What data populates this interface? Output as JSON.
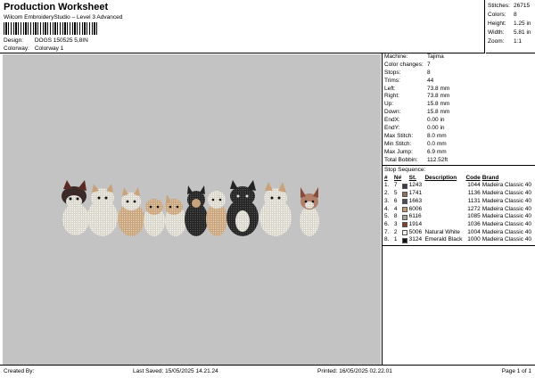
{
  "header": {
    "title": "Production Worksheet",
    "subtitle": "Wilcom EmbroideryStudio – Level 3 Advanced",
    "design_label": "Design:",
    "design_value": "DOGS 150525 5,8IN",
    "colorway_label": "Colorway:",
    "colorway_value": "Colorway 1"
  },
  "summary": {
    "stitches_label": "Stitches:",
    "stitches": "26715",
    "colors_label": "Colors:",
    "colors": "8",
    "height_label": "Height:",
    "height": "1.25 in",
    "width_label": "Width:",
    "width": "5.81 in",
    "zoom_label": "Zoom:",
    "zoom": "1:1"
  },
  "stats": [
    {
      "k": "Machine:",
      "v": "Tajima"
    },
    {
      "k": "Color changes:",
      "v": "7"
    },
    {
      "k": "Stops:",
      "v": "8"
    },
    {
      "k": "Trims:",
      "v": "44"
    },
    {
      "k": "Left:",
      "v": "73.8 mm"
    },
    {
      "k": "Right:",
      "v": "73.8 mm"
    },
    {
      "k": "Up:",
      "v": "15.8 mm"
    },
    {
      "k": "Down:",
      "v": "15.8 mm"
    },
    {
      "k": "EndX:",
      "v": "0.00 in"
    },
    {
      "k": "EndY:",
      "v": "0.00 in"
    },
    {
      "k": "Max Stitch:",
      "v": "8.0 mm"
    },
    {
      "k": "Min Stitch:",
      "v": "0.0 mm"
    },
    {
      "k": "Max Jump:",
      "v": "6.9 mm"
    },
    {
      "k": "Total Bobbin:",
      "v": "112.52ft"
    }
  ],
  "stop_sequence": {
    "title": "Stop Sequence:",
    "headers": {
      "num": "#",
      "n": "N#",
      "st": "St.",
      "desc": "Description",
      "code": "Code",
      "brand": "Brand"
    },
    "rows": [
      {
        "num": "1.",
        "n": "7",
        "color": "#3b3a4a",
        "st": "1243",
        "desc": "",
        "code": "1044",
        "brand": "Madeira Classic 40"
      },
      {
        "num": "2.",
        "n": "5",
        "color": "#8a7060",
        "st": "1741",
        "desc": "",
        "code": "1136",
        "brand": "Madeira Classic 40"
      },
      {
        "num": "3.",
        "n": "6",
        "color": "#4a4e58",
        "st": "1663",
        "desc": "",
        "code": "1131",
        "brand": "Madeira Classic 40"
      },
      {
        "num": "4.",
        "n": "4",
        "color": "#c89a72",
        "st": "6006",
        "desc": "",
        "code": "1272",
        "brand": "Madeira Classic 40"
      },
      {
        "num": "5.",
        "n": "8",
        "color": "#a8a49a",
        "st": "6116",
        "desc": "",
        "code": "1085",
        "brand": "Madeira Classic 40"
      },
      {
        "num": "6.",
        "n": "3",
        "color": "#7a4030",
        "st": "1914",
        "desc": "",
        "code": "1036",
        "brand": "Madeira Classic 40"
      },
      {
        "num": "7.",
        "n": "2",
        "color": "#f4f2ea",
        "st": "5006",
        "desc": "Natural White",
        "code": "1004",
        "brand": "Madeira Classic 40"
      },
      {
        "num": "8.",
        "n": "1",
        "color": "#111111",
        "st": "3124",
        "desc": "Emerald Black",
        "code": "1000",
        "brand": "Madeira Classic 40"
      }
    ]
  },
  "footer": {
    "created_by": "Created By:",
    "last_saved": "Last Saved: 15/05/2025 14.21.24",
    "printed": "Printed: 16/05/2025 02.22.01",
    "page": "Page 1 of 1"
  },
  "colors": {
    "canvas": "#c3c3c3"
  }
}
